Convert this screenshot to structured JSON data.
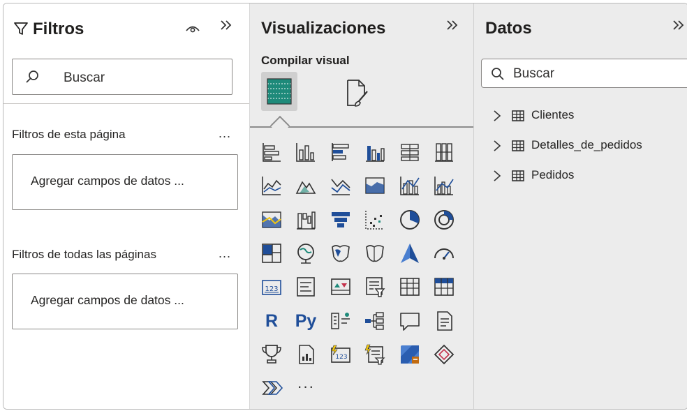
{
  "filters": {
    "title": "Filtros",
    "search_placeholder": "Buscar",
    "page_section_label": "Filtros de esta página",
    "page_drop_label": "Agregar campos de datos ...",
    "all_section_label": "Filtros de todas las páginas",
    "all_drop_label": "Agregar campos de datos ...",
    "more_label": "..."
  },
  "visualizations": {
    "title": "Visualizaciones",
    "build_label": "Compilar visual",
    "icons": [
      "stacked-bar-chart-icon",
      "stacked-column-chart-icon",
      "clustered-bar-chart-icon",
      "clustered-column-chart-icon",
      "100-stacked-bar-chart-icon",
      "100-stacked-column-chart-icon",
      "line-chart-icon",
      "area-chart-icon",
      "stacked-area-chart-icon",
      "100-stacked-area-chart-icon",
      "line-and-stacked-column-chart-icon",
      "line-and-clustered-column-chart-icon",
      "ribbon-chart-icon",
      "waterfall-chart-icon",
      "funnel-chart-icon",
      "scatter-chart-icon",
      "pie-chart-icon",
      "donut-chart-icon",
      "treemap-icon",
      "map-icon",
      "filled-map-icon",
      "shape-map-icon",
      "azure-map-icon",
      "gauge-icon",
      "card-icon",
      "multi-row-card-icon",
      "kpi-icon",
      "slicer-icon",
      "table-icon",
      "matrix-icon",
      "r-script-visual-icon",
      "python-visual-icon",
      "key-influencers-icon",
      "decomposition-tree-icon",
      "qa-icon",
      "smart-narrative-icon",
      "metrics-icon",
      "paginated-report-icon",
      "power-apps-card-icon",
      "power-apps-slicer-icon",
      "power-apps-icon",
      "power-automate-icon",
      "power-bi-visual-icon",
      "more-visuals-icon"
    ],
    "r_label": "R",
    "py_label": "Py",
    "more_label": "···"
  },
  "data": {
    "title": "Datos",
    "search_placeholder": "Buscar",
    "tables": [
      {
        "label": "Clientes"
      },
      {
        "label": "Detalles_de_pedidos"
      },
      {
        "label": "Pedidos"
      }
    ]
  },
  "colors": {
    "accent_blue": "#1f4e99",
    "teal": "#1e8a7a",
    "yellow": "#f2c811",
    "pane_gray": "#ececec"
  }
}
